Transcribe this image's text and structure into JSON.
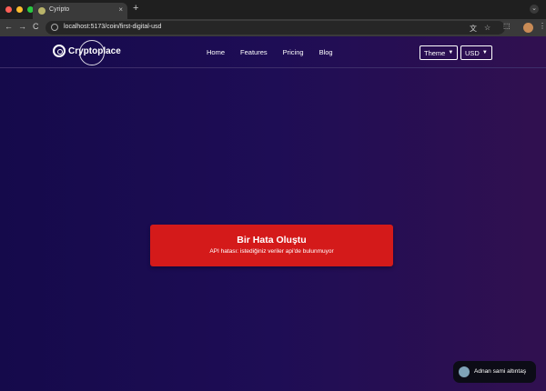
{
  "browser": {
    "tab_title": "Cyripto",
    "tab_close": "×",
    "new_tab": "+",
    "tab_dropdown": "⌄",
    "url": "localhost:5173/coin/first-digital-usd",
    "back": "←",
    "forward": "→",
    "reload": "C",
    "translate_icon": "文",
    "star_icon": "☆",
    "extensions_icon": "⬚",
    "menu_icon": "⋮",
    "lights": [
      "#ff5f57",
      "#febc2e",
      "#28c840"
    ]
  },
  "header": {
    "logo_text": "Cryptoplace",
    "nav": [
      "Home",
      "Features",
      "Pricing",
      "Blog"
    ],
    "theme_label": "Theme",
    "currency_label": "USD"
  },
  "error": {
    "title": "Bir Hata Oluştu",
    "message": "API hatası: istediğiniz veriler api'de bulunmuyor"
  },
  "user": {
    "name": "Adnan sami altıntaş"
  }
}
